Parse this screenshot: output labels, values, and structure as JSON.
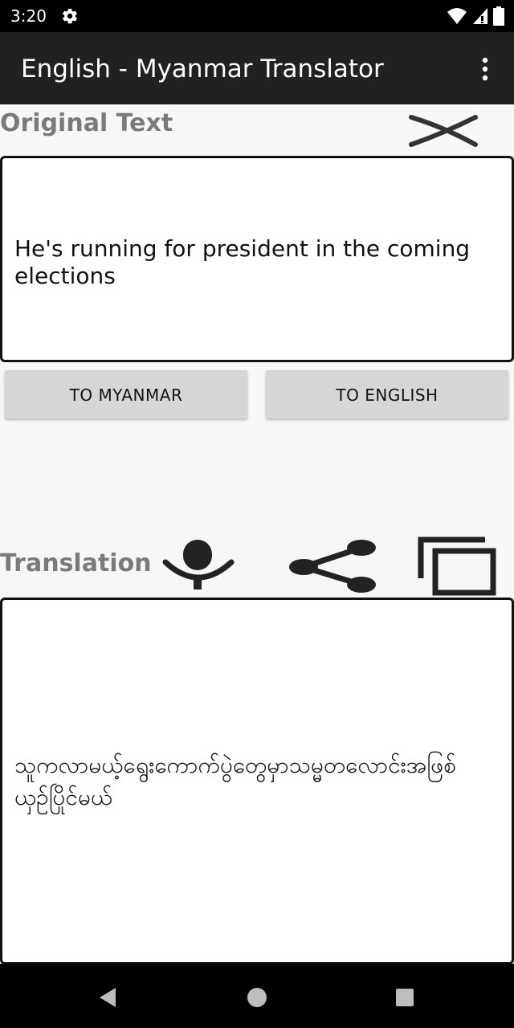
{
  "status_bar": {
    "time": "3:20"
  },
  "app_bar": {
    "title": "English - Myanmar Translator"
  },
  "original": {
    "label": "Original Text",
    "text": "He's running for president in the coming elections"
  },
  "buttons": {
    "to_myanmar": "TO MYANMAR",
    "to_english": "TO ENGLISH"
  },
  "translation": {
    "label": "Translation",
    "text": "သူကလာမယ့်ရွေးကောက်ပွဲတွေမှာသမ္မတလောင်းအဖြစ်ယှဉ်ပြိုင်မယ်"
  },
  "icons": {
    "settings": "gear-icon",
    "wifi": "wifi-icon",
    "signal": "signal-icon",
    "battery": "battery-icon",
    "menu": "more-vert-icon",
    "clear": "close-icon",
    "mic": "microphone-icon",
    "share": "share-icon",
    "copy": "copy-icon",
    "back": "back-icon",
    "home": "home-icon",
    "recents": "recents-icon"
  }
}
